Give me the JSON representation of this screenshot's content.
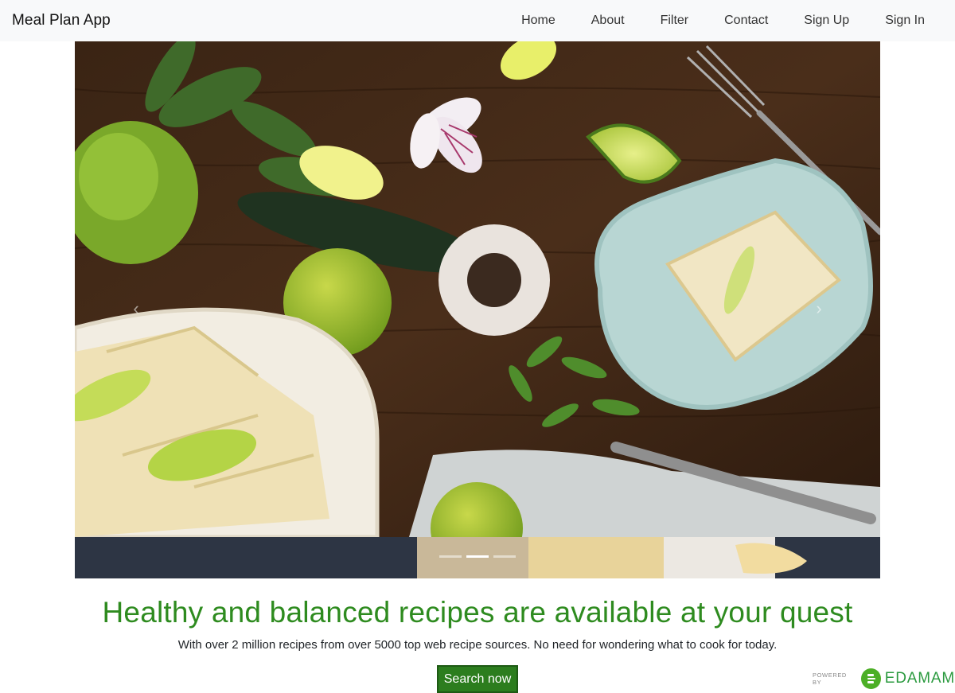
{
  "navbar": {
    "brand": "Meal Plan App",
    "links": [
      "Home",
      "About",
      "Filter",
      "Contact",
      "Sign Up",
      "Sign In"
    ]
  },
  "carousel": {
    "slide_count": 3,
    "active_index": 1,
    "prev_icon": "chevron-left-icon",
    "next_icon": "chevron-right-icon"
  },
  "hero": {
    "headline": "Healthy and balanced recipes are available at your quest",
    "subline": "With over 2 million recipes from over 5000 top web recipe sources. No need for wondering what to cook for today.",
    "cta_label": "Search now"
  },
  "powered_by": {
    "label": "POWERED BY",
    "brand": "EDAMAM"
  },
  "colors": {
    "headline": "#2e8b1f",
    "button": "#2c7d1e",
    "navbar_bg": "#f8f9fa",
    "edamam_green": "#4caf26"
  }
}
